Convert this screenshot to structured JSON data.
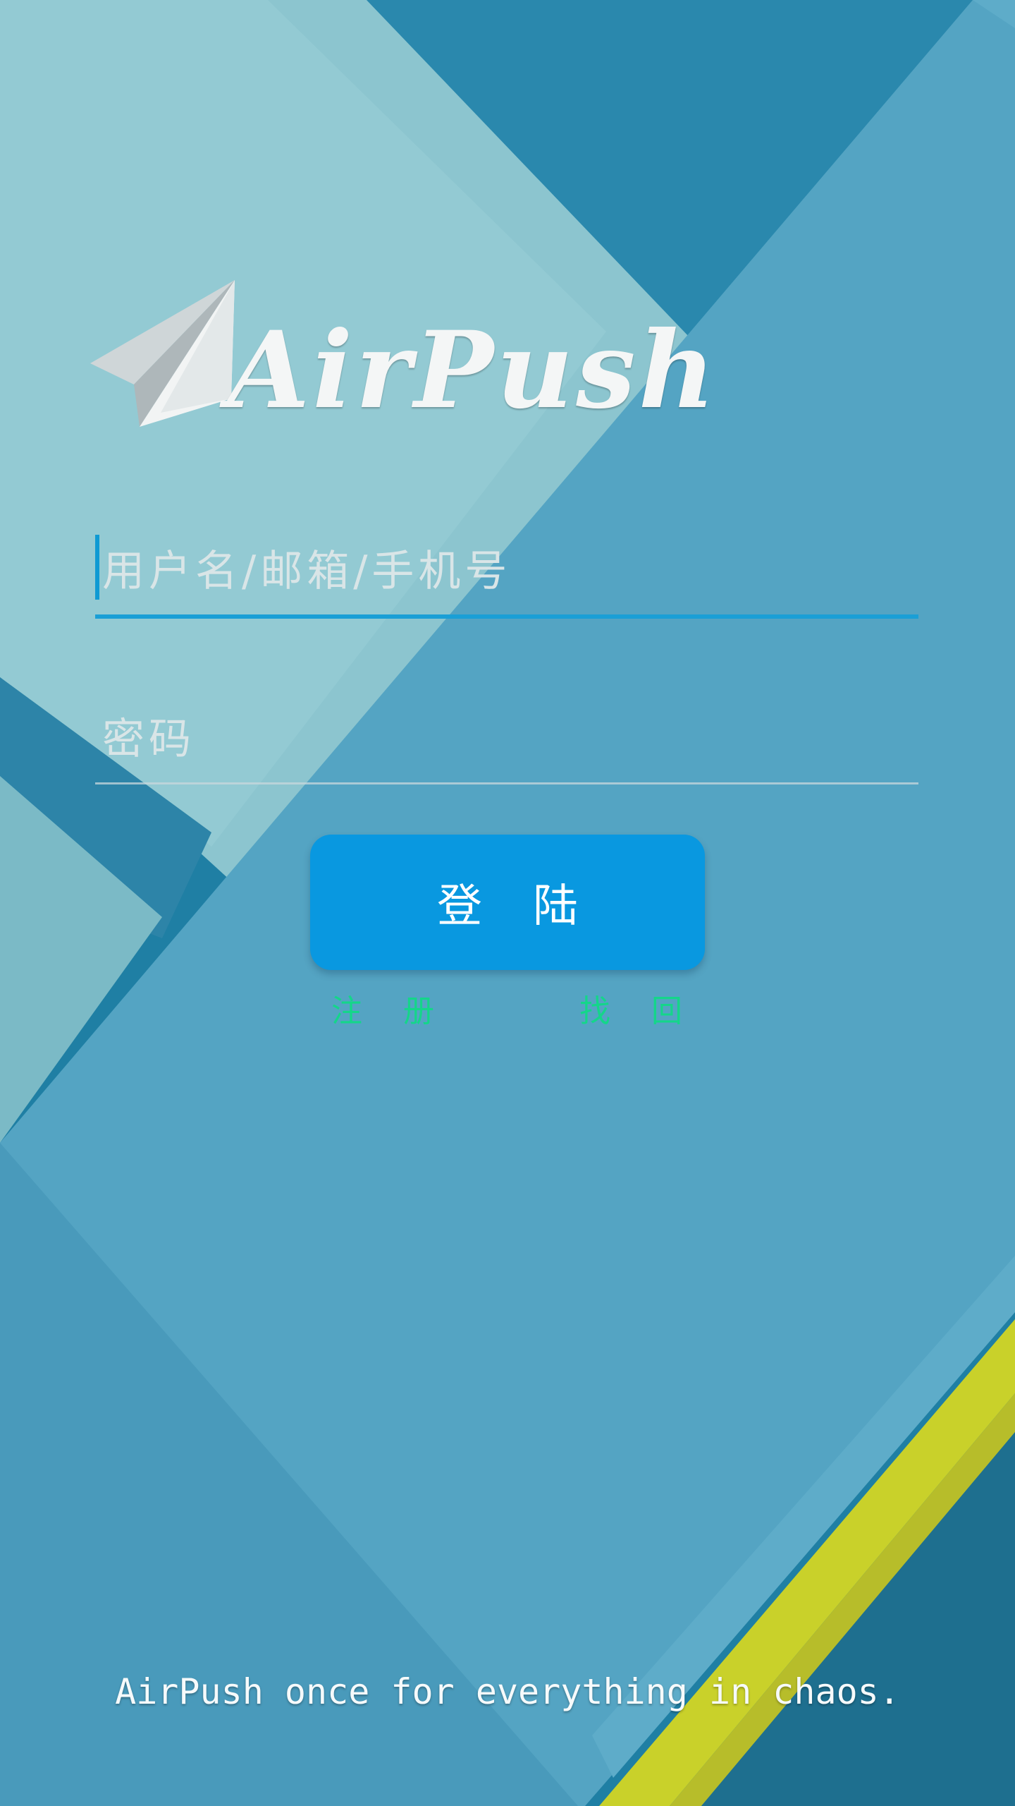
{
  "app": {
    "name": "AirPush"
  },
  "logo": {
    "icon": "paper-plane-icon",
    "text": "AirPush"
  },
  "login_form": {
    "username_placeholder": "用户名/邮箱/手机号",
    "password_placeholder": "密码",
    "submit_label": "登陆",
    "register_label": "注册",
    "forgot_label": "找回"
  },
  "footer": {
    "tagline": "AirPush once for everything in chaos."
  },
  "colors": {
    "accent": "#0998e0",
    "link": "#14d68a",
    "underline_active": "#1a9fd6",
    "background_blue": "#4f9fbe",
    "stripe_yellow": "#c9d12a"
  }
}
